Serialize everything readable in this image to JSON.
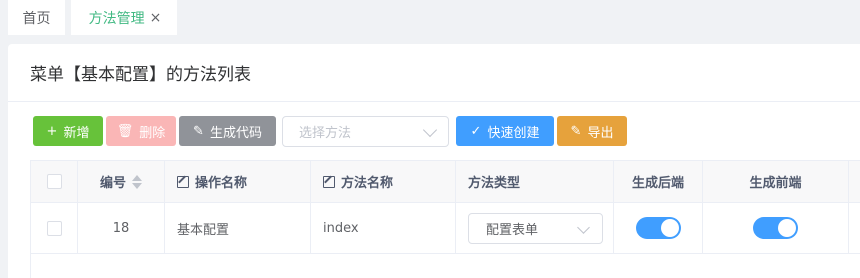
{
  "tabs": {
    "home": "首页",
    "active": "方法管理",
    "close_icon": "×"
  },
  "card": {
    "title": "菜单【基本配置】的方法列表"
  },
  "toolbar": {
    "add": {
      "label": "新增",
      "icon": "+"
    },
    "delete": {
      "label": "删除",
      "icon": "🗑"
    },
    "generate": {
      "label": "生成代码",
      "icon": "✎"
    },
    "method_select": {
      "placeholder": "选择方法"
    },
    "quick_create": {
      "label": "快速创建",
      "icon": "✓"
    },
    "export": {
      "label": "导出",
      "icon": "✎"
    }
  },
  "colors": {
    "brand": "#42b983",
    "success": "#67c23a",
    "danger_disabled": "#fab6b6",
    "info": "#909399",
    "primary": "#409eff",
    "warning": "#e6a23c"
  },
  "table": {
    "columns": [
      "",
      "编号",
      "操作名称",
      "方法名称",
      "方法类型",
      "生成后端",
      "生成前端"
    ],
    "rows": [
      {
        "id": "18",
        "operation_name": "基本配置",
        "method_name": "index",
        "method_type": "配置表单",
        "gen_backend": true,
        "gen_frontend": true
      }
    ]
  }
}
